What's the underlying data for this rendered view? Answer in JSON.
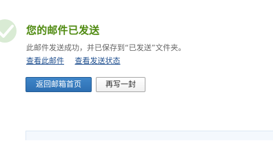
{
  "status": {
    "title": "您的邮件已发送",
    "description": "此邮件发送成功，并已保存到“已发送”文件夹。"
  },
  "links": {
    "view_mail": "查看此邮件",
    "view_status": "查看发送状态"
  },
  "actions": {
    "back_to_inbox": "返回邮箱首页",
    "write_another": "再写一封"
  },
  "icon": {
    "name": "check-circle-icon",
    "color": "#d9ebd4"
  }
}
